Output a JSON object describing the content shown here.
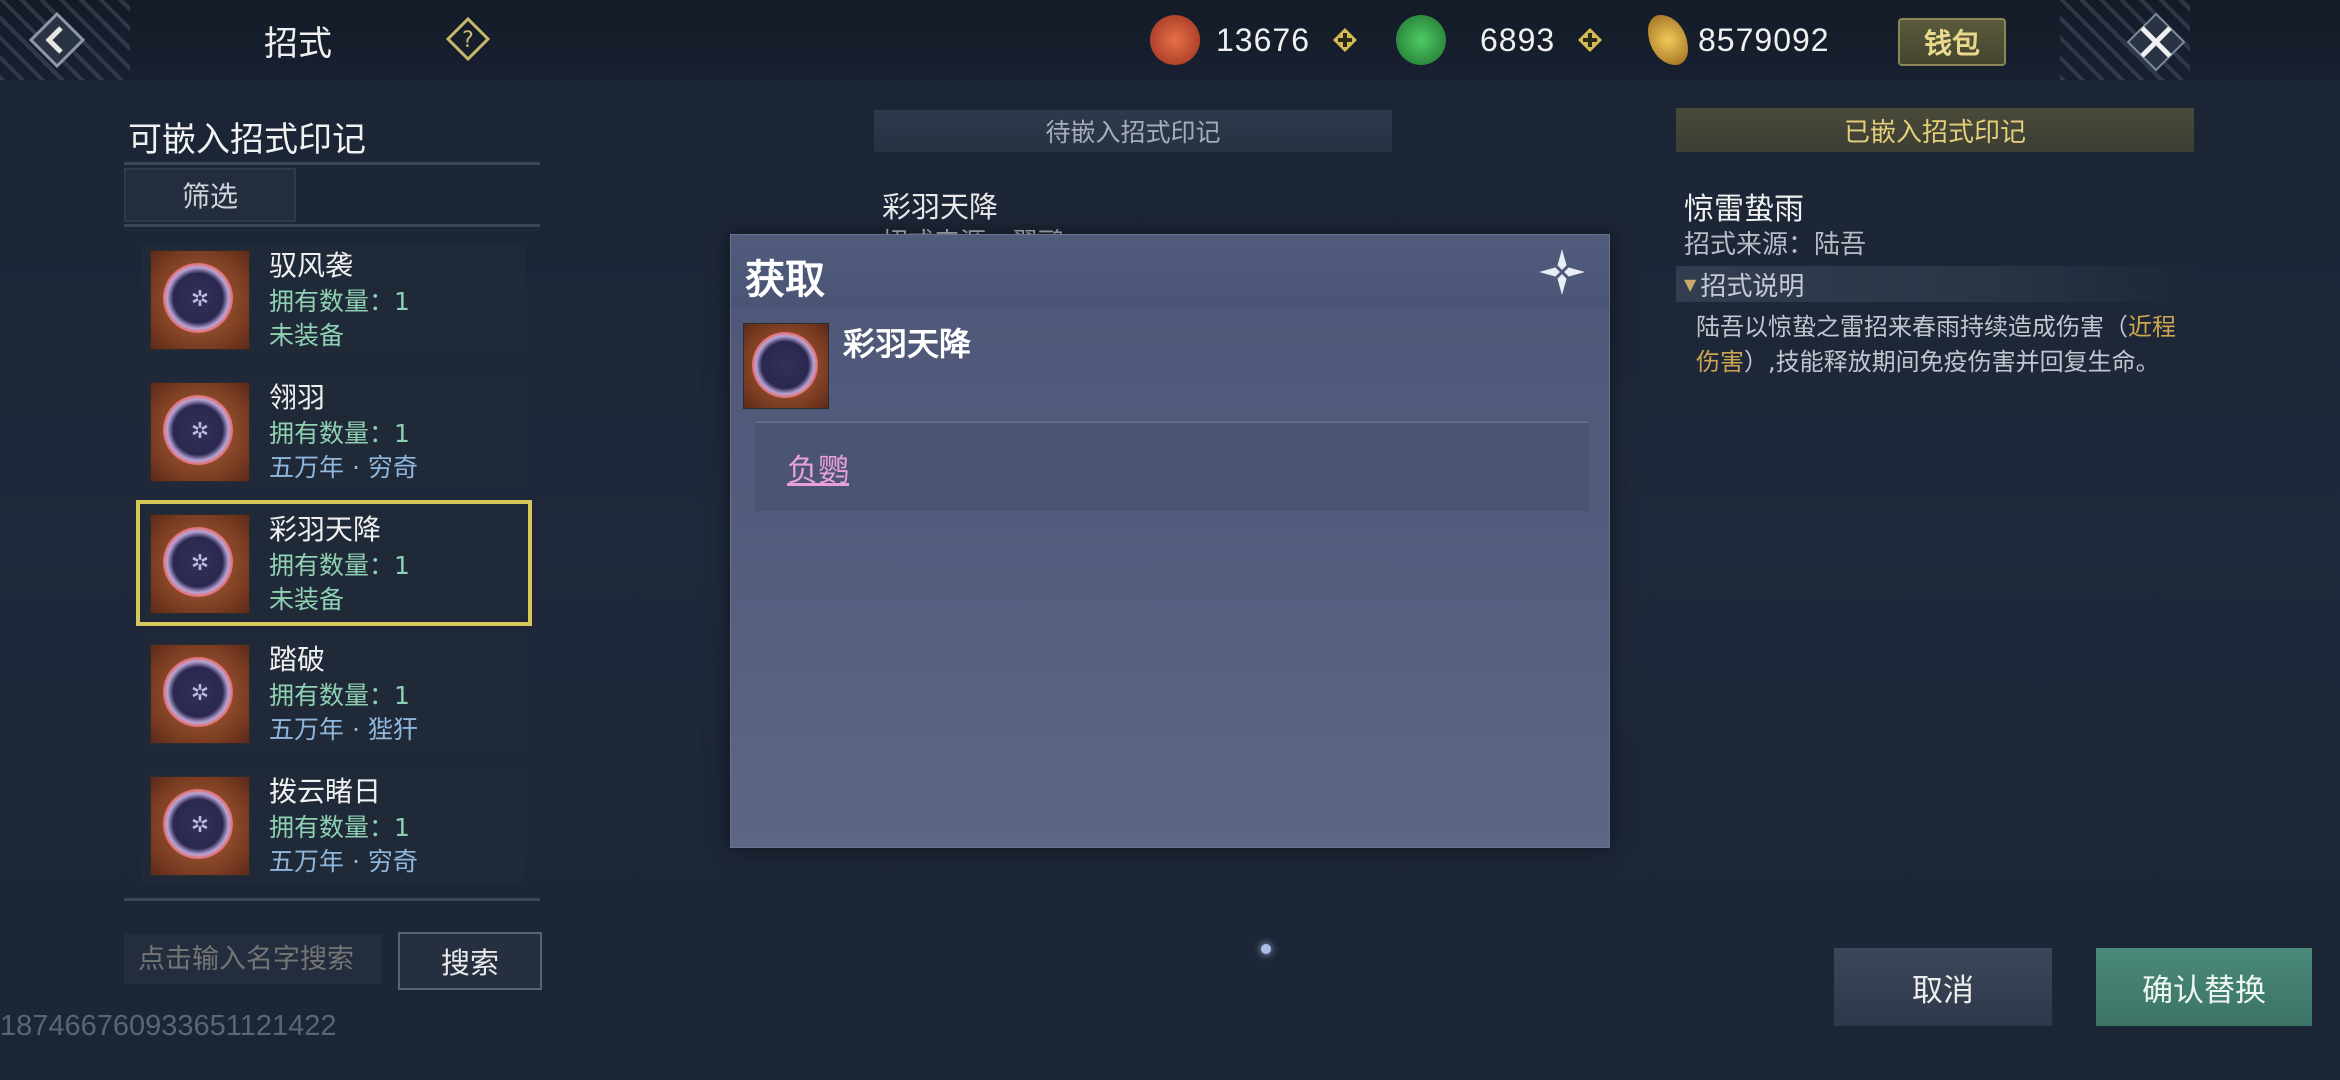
{
  "header": {
    "title": "招式",
    "wallet_label": "钱包",
    "currencies": [
      {
        "icon": "red-swirl-coin-icon",
        "value": "13676"
      },
      {
        "icon": "jade-coin-icon",
        "value": "6893"
      },
      {
        "icon": "gold-leaf-icon",
        "value": "8579092"
      }
    ]
  },
  "left": {
    "title": "可嵌入招式印记",
    "filter_label": "筛选",
    "items": [
      {
        "name": "驭风袭",
        "owned": "拥有数量：1",
        "status": "未装备",
        "status_color": "#8ed0b2"
      },
      {
        "name": "翎羽",
        "owned": "拥有数量：1",
        "status": "五万年 · 穷奇",
        "status_color": "#8fb7dd"
      },
      {
        "name": "彩羽天降",
        "owned": "拥有数量：1",
        "status": "未装备",
        "status_color": "#8ed0b2"
      },
      {
        "name": "踏破",
        "owned": "拥有数量：1",
        "status": "五万年 · 狴犴",
        "status_color": "#8fb7dd"
      },
      {
        "name": "拨云睹日",
        "owned": "拥有数量：1",
        "status": "五万年 · 穷奇",
        "status_color": "#8fb7dd"
      }
    ],
    "search_placeholder": "点击输入名字搜索",
    "search_label": "搜索",
    "uid": "18746676093365112142​2"
  },
  "middle": {
    "header": "待嵌入招式印记",
    "name": "彩羽天降",
    "source": "招式来源：翠鹂"
  },
  "right": {
    "header": "已嵌入招式印记",
    "name": "惊雷蛰雨",
    "source": "招式来源：陆吾",
    "section": "招式说明",
    "desc_a": "陆吾以惊蛰之雷招来春雨持续造成伤害（",
    "desc_hl": "近程伤害",
    "desc_b": "）,技能释放期间免疫伤害并回复生命。"
  },
  "actions": {
    "cancel": "取消",
    "confirm": "确认替换"
  },
  "modal": {
    "title": "获取",
    "item_name": "彩羽天降",
    "source_link": "负鹦"
  }
}
